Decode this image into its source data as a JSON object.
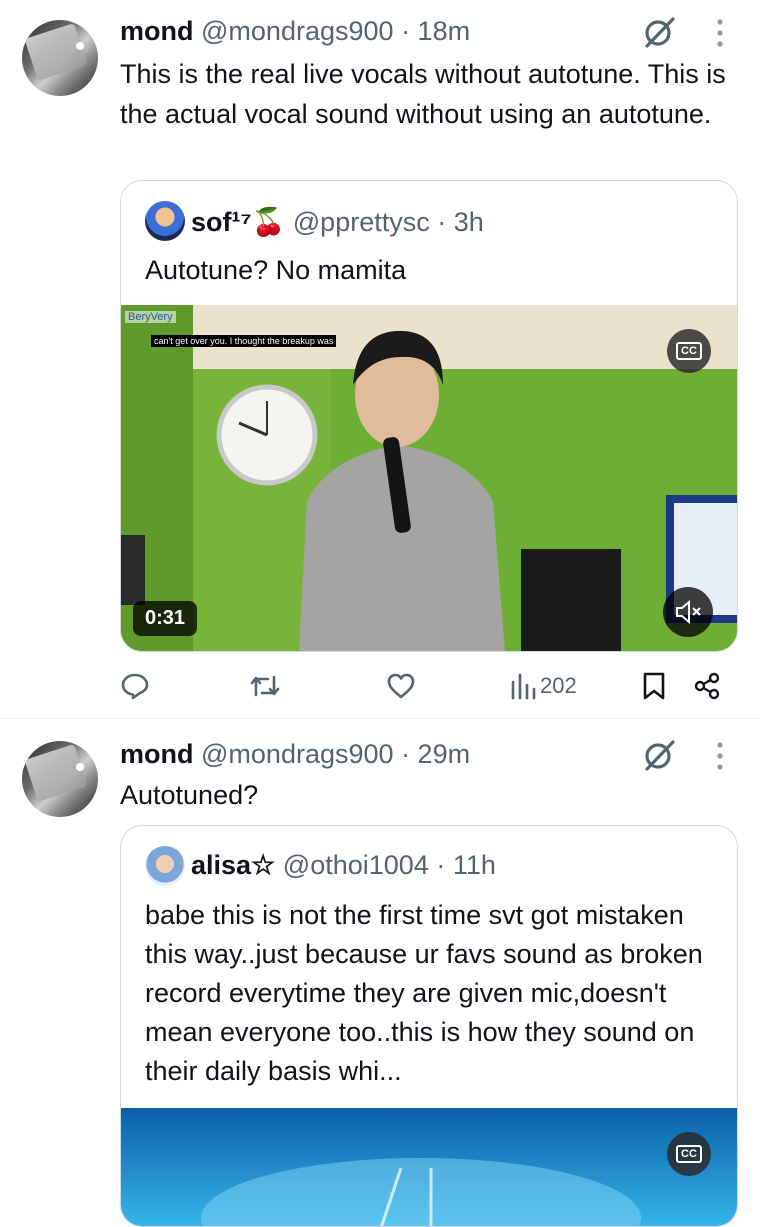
{
  "tweets": [
    {
      "name": "mond",
      "handle": "@mondrags900",
      "time": "· 18m",
      "text": "This is the real live vocals without autotune. This is the actual vocal sound without using an autotune.",
      "quote": {
        "name": "sof¹⁷🍒",
        "handle": "@pprettysc",
        "time": "· 3h",
        "text": "Autotune? No mamita",
        "video": {
          "watermark": "BeryVery",
          "subtitle": "can't get over you. I thought the breakup was",
          "duration": "0:31",
          "cc_label": "CC"
        }
      },
      "actions": {
        "views": "202"
      }
    },
    {
      "name": "mond",
      "handle": "@mondrags900",
      "time": "· 29m",
      "text": "Autotuned?",
      "quote": {
        "name": "alisa☆",
        "handle": "@othoi1004",
        "time": "· 11h",
        "text": "babe this is not the first time svt got mistaken this way..just because ur favs sound as broken record everytime they are given mic,doesn't mean everyone too..this is how they sound on their daily basis whi...",
        "video": {
          "cc_label": "CC"
        }
      }
    }
  ],
  "icons": [
    "grok-icon",
    "more-icon",
    "reply-icon",
    "retweet-icon",
    "like-icon",
    "views-icon",
    "bookmark-icon",
    "share-icon",
    "mute-icon",
    "cc-icon"
  ],
  "colors": {
    "text": "#0f1419",
    "secondary": "#536471",
    "border": "#cfd9de",
    "wall_green": "#78b43a"
  }
}
